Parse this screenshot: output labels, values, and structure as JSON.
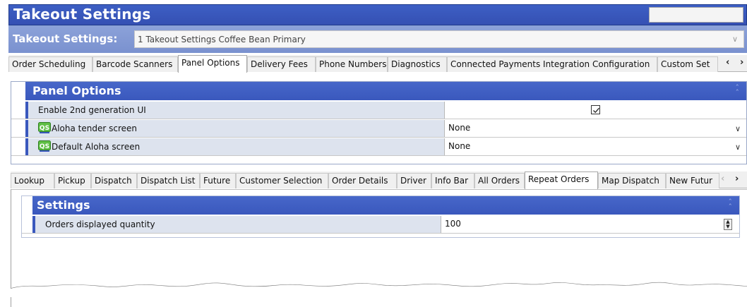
{
  "window": {
    "title": "Takeout Settings"
  },
  "selector": {
    "label": "Takeout Settings:",
    "value": "1 Takeout Settings Coffee Bean Primary"
  },
  "main_tabs": [
    {
      "label": "Order Scheduling"
    },
    {
      "label": "Barcode Scanners"
    },
    {
      "label": "Panel Options",
      "active": true
    },
    {
      "label": "Delivery Fees"
    },
    {
      "label": "Phone Numbers"
    },
    {
      "label": "Diagnostics"
    },
    {
      "label": "Connected Payments Integration Configuration"
    },
    {
      "label": "Custom Set"
    }
  ],
  "panel_options": {
    "heading": "Panel Options",
    "rows": [
      {
        "label": "Enable 2nd generation UI",
        "type": "checkbox",
        "checked": true
      },
      {
        "label": "Aloha tender screen",
        "type": "select",
        "value": "None",
        "badge": "QS"
      },
      {
        "label": "Default Aloha screen",
        "type": "select",
        "value": "None",
        "badge": "QS"
      }
    ]
  },
  "sub_tabs": [
    {
      "label": "Lookup"
    },
    {
      "label": "Pickup"
    },
    {
      "label": "Dispatch"
    },
    {
      "label": "Dispatch List"
    },
    {
      "label": "Future"
    },
    {
      "label": "Customer Selection"
    },
    {
      "label": "Order Details"
    },
    {
      "label": "Driver"
    },
    {
      "label": "Info Bar"
    },
    {
      "label": "All Orders"
    },
    {
      "label": "Repeat Orders",
      "active": true
    },
    {
      "label": "Map Dispatch"
    },
    {
      "label": "New Futur"
    }
  ],
  "settings": {
    "heading": "Settings",
    "rows": [
      {
        "label": "Orders displayed quantity",
        "type": "spinner",
        "value": "100"
      }
    ]
  },
  "colors": {
    "accent": "#3a58bd",
    "header_light": "#7a91cf",
    "row_label_bg": "#dde3ee"
  },
  "icons": {
    "qs_badge": "qs-badge-icon",
    "collapse": "double-chevron-up-icon",
    "dropdown": "chevron-down-icon",
    "spinner": "spinner-arrows-icon"
  }
}
